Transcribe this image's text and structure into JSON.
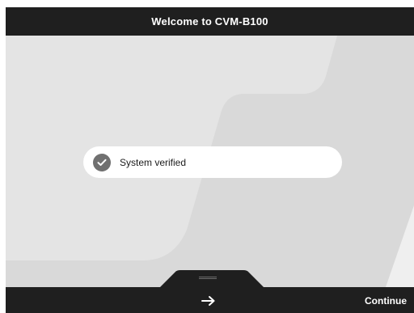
{
  "header": {
    "title": "Welcome to CVM-B100"
  },
  "status": {
    "text": "System verified",
    "icon": "check-circle-icon"
  },
  "footer": {
    "continue_label": "Continue",
    "arrow_icon": "arrow-right-icon"
  },
  "colors": {
    "bar": "#1f1f1f",
    "background": "#d9d9d9",
    "panel_light": "#e4e4e4",
    "pill": "#ffffff",
    "icon": "#707070"
  }
}
